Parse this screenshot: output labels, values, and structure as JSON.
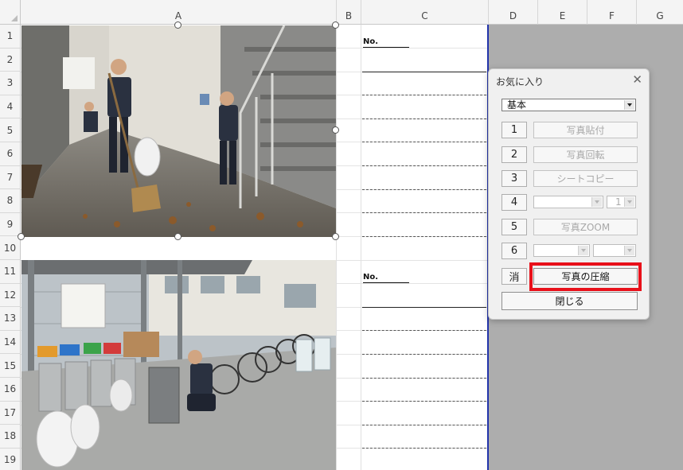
{
  "columns": [
    "A",
    "B",
    "C",
    "D",
    "E",
    "F",
    "G"
  ],
  "rows": [
    "1",
    "2",
    "3",
    "4",
    "5",
    "6",
    "7",
    "8",
    "9",
    "10",
    "11",
    "12",
    "13",
    "14",
    "15",
    "16",
    "17",
    "18",
    "19"
  ],
  "sheet": {
    "no_label_1": "No.",
    "no_label_2": "No."
  },
  "dialog": {
    "title": "お気に入り",
    "preset_select": "基本",
    "buttons": [
      {
        "num": "1",
        "label": "写真貼付",
        "enabled": false
      },
      {
        "num": "2",
        "label": "写真回転",
        "enabled": false
      },
      {
        "num": "3",
        "label": "シートコピー",
        "enabled": false
      },
      {
        "num": "4",
        "label": "",
        "enabled": false
      },
      {
        "num": "5",
        "label": "写真ZOOM",
        "enabled": false
      },
      {
        "num": "6",
        "label": "",
        "enabled": false
      }
    ],
    "row4_count": "1",
    "clear_label": "消",
    "compress_label": "写真の圧縮",
    "close_label": "閉じる"
  },
  "colors": {
    "highlight": "#e8101a",
    "selection_border": "#2233aa"
  },
  "icons": [
    "close-icon",
    "dropdown-arrow-icon"
  ]
}
